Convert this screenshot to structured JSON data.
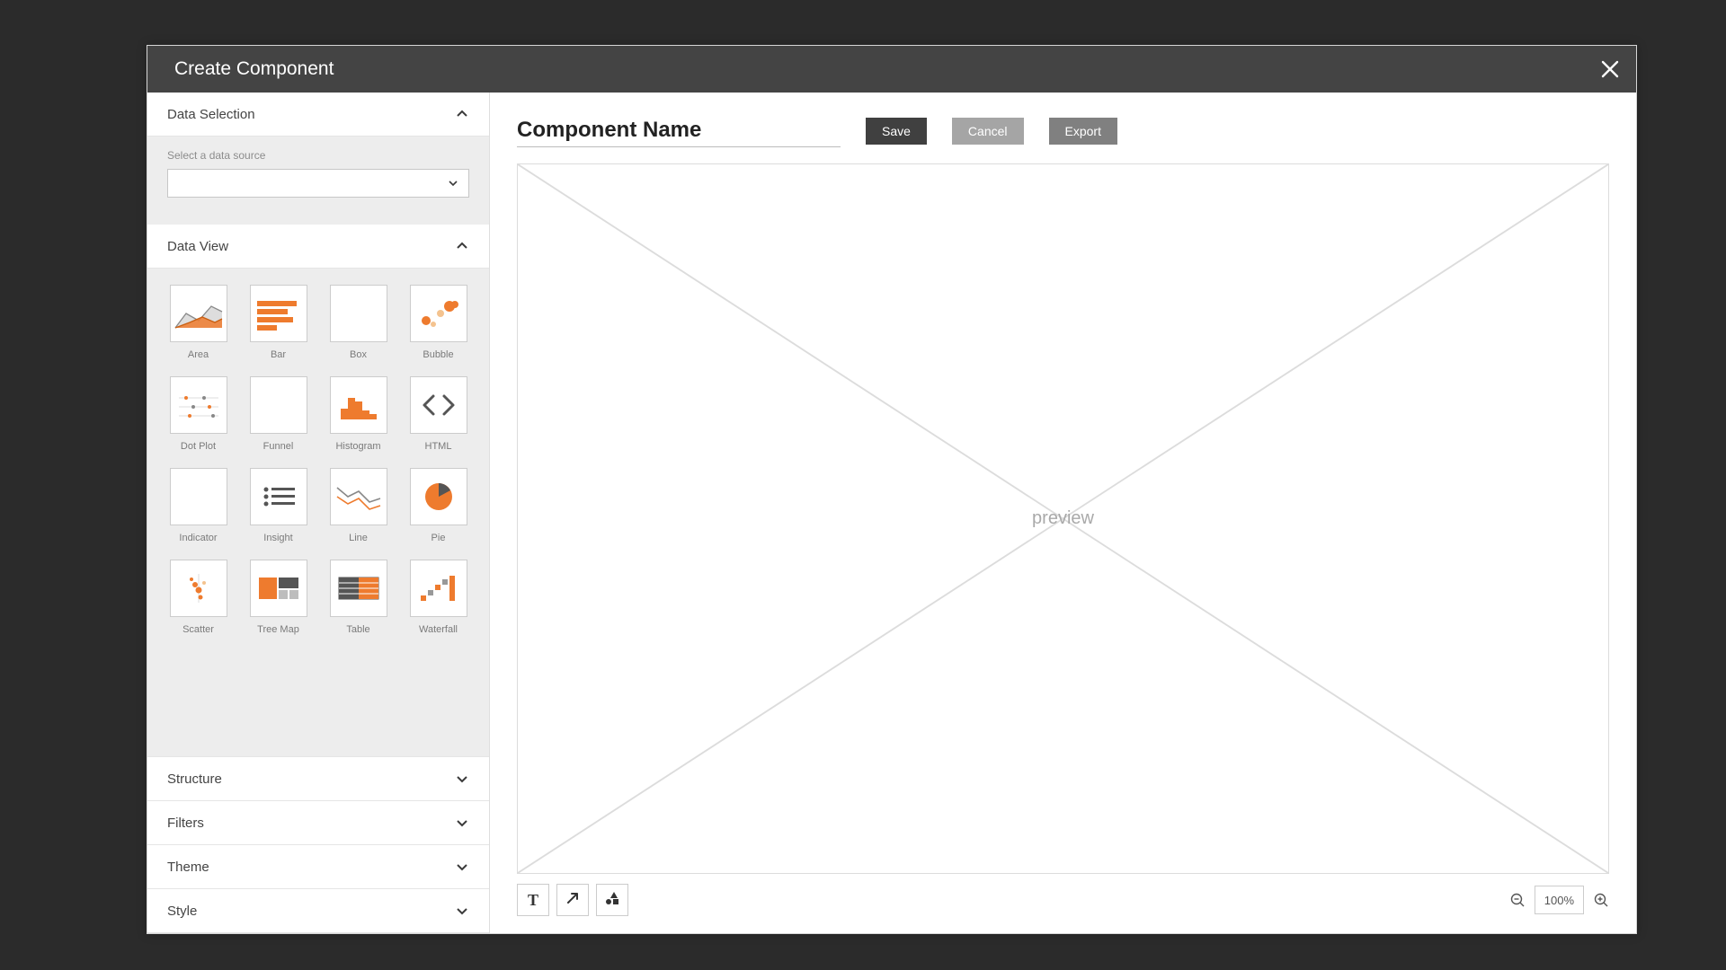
{
  "modal": {
    "title": "Create Component"
  },
  "sidebar": {
    "sections": {
      "data_selection": {
        "title": "Data Selection",
        "label": "Select a data source",
        "value": ""
      },
      "data_view": {
        "title": "Data View",
        "items": [
          {
            "label": "Area"
          },
          {
            "label": "Bar"
          },
          {
            "label": "Box"
          },
          {
            "label": "Bubble"
          },
          {
            "label": "Dot Plot"
          },
          {
            "label": "Funnel"
          },
          {
            "label": "Histogram"
          },
          {
            "label": "HTML"
          },
          {
            "label": "Indicator"
          },
          {
            "label": "Insight"
          },
          {
            "label": "Line"
          },
          {
            "label": "Pie"
          },
          {
            "label": "Scatter"
          },
          {
            "label": "Tree Map"
          },
          {
            "label": "Table"
          },
          {
            "label": "Waterfall"
          }
        ]
      },
      "collapsed": [
        {
          "title": "Structure"
        },
        {
          "title": "Filters"
        },
        {
          "title": "Theme"
        },
        {
          "title": "Style"
        }
      ]
    }
  },
  "main": {
    "name_placeholder": "Component Name",
    "buttons": {
      "save": "Save",
      "cancel": "Cancel",
      "export": "Export"
    },
    "preview_label": "preview",
    "zoom": "100%"
  },
  "colors": {
    "accent": "#ee7b2e",
    "dark": "#555555"
  }
}
